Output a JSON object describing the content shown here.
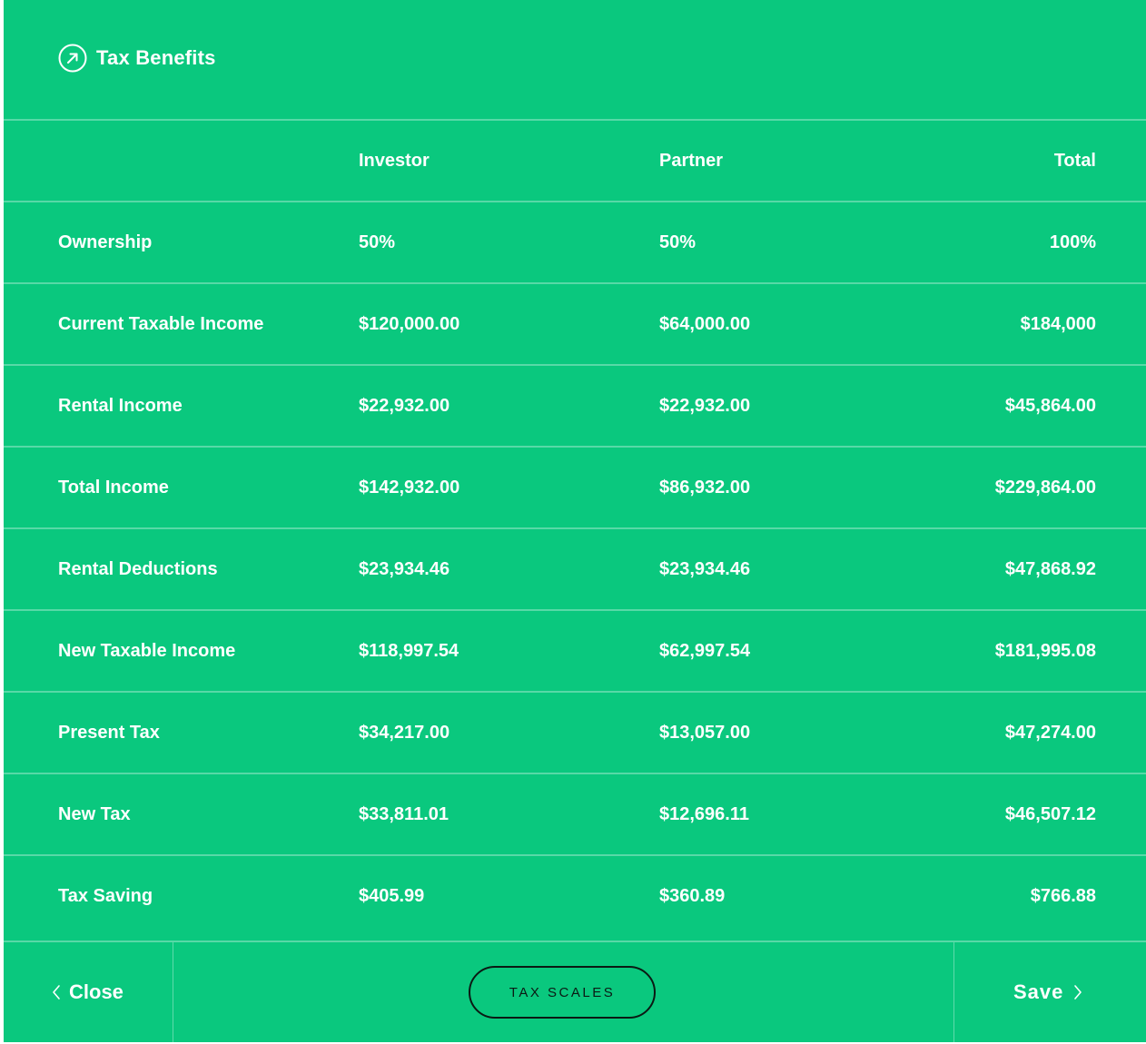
{
  "header": {
    "title": "Tax Benefits",
    "icon": "arrow-up-right-circle-icon"
  },
  "table": {
    "columns": [
      "",
      "Investor",
      "Partner",
      "Total"
    ],
    "rows": [
      {
        "label": "Ownership",
        "investor": "50%",
        "partner": "50%",
        "total": "100%"
      },
      {
        "label": "Current Taxable Income",
        "investor": "$120,000.00",
        "partner": "$64,000.00",
        "total": "$184,000"
      },
      {
        "label": "Rental Income",
        "investor": "$22,932.00",
        "partner": "$22,932.00",
        "total": "$45,864.00"
      },
      {
        "label": "Total Income",
        "investor": "$142,932.00",
        "partner": "$86,932.00",
        "total": "$229,864.00"
      },
      {
        "label": "Rental Deductions",
        "investor": "$23,934.46",
        "partner": "$23,934.46",
        "total": "$47,868.92"
      },
      {
        "label": "New Taxable Income",
        "investor": "$118,997.54",
        "partner": "$62,997.54",
        "total": "$181,995.08"
      },
      {
        "label": "Present Tax",
        "investor": "$34,217.00",
        "partner": "$13,057.00",
        "total": "$47,274.00"
      },
      {
        "label": "New Tax",
        "investor": "$33,811.01",
        "partner": "$12,696.11",
        "total": "$46,507.12"
      },
      {
        "label": "Tax Saving",
        "investor": "$405.99",
        "partner": "$360.89",
        "total": "$766.88"
      }
    ]
  },
  "footer": {
    "close_label": "Close",
    "tax_scales_label": "TAX SCALES",
    "save_label": "Save"
  },
  "colors": {
    "background": "#0ac87e",
    "text": "#ffffff",
    "button_outline": "#0b1a14"
  }
}
